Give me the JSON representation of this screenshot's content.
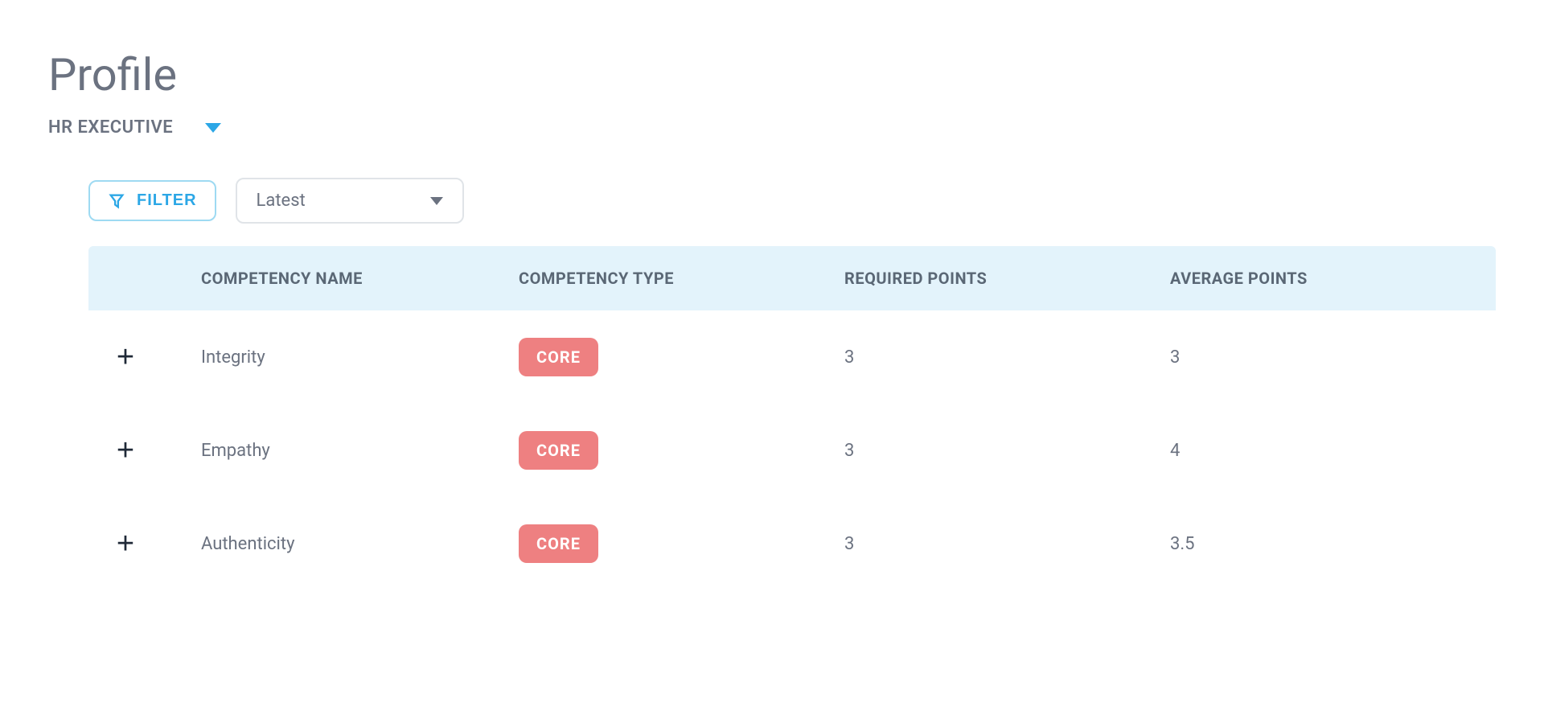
{
  "header": {
    "title": "Profile",
    "role_selected": "HR EXECUTIVE"
  },
  "toolbar": {
    "filter_label": "FILTER",
    "sort_selected": "Latest"
  },
  "table": {
    "columns": {
      "name": "COMPETENCY NAME",
      "type": "COMPETENCY TYPE",
      "required": "REQUIRED POINTS",
      "average": "AVERAGE POINTS"
    },
    "rows": [
      {
        "name": "Integrity",
        "type": "CORE",
        "required": "3",
        "average": "3"
      },
      {
        "name": "Empathy",
        "type": "CORE",
        "required": "3",
        "average": "4"
      },
      {
        "name": "Authenticity",
        "type": "CORE",
        "required": "3",
        "average": "3.5"
      }
    ]
  },
  "colors": {
    "accent_blue": "#2ca7e6",
    "header_bg": "#e3f3fb",
    "badge_bg": "#ee8081"
  }
}
